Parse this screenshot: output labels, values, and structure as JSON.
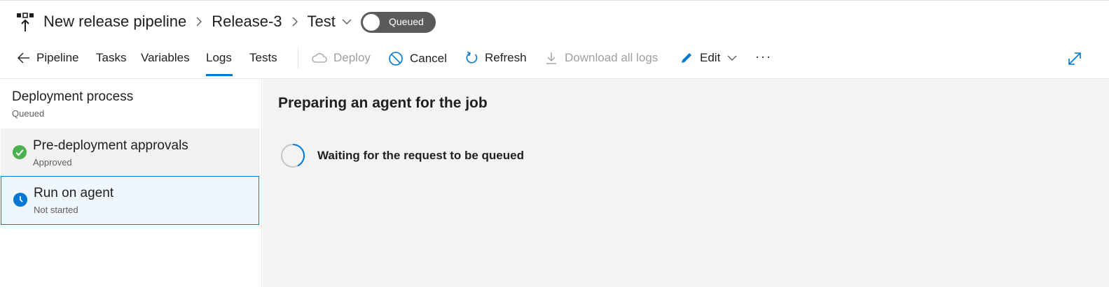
{
  "header": {
    "breadcrumbs": [
      "New release pipeline",
      "Release-3",
      "Test"
    ],
    "status_toggle": "Queued"
  },
  "toolbar": {
    "tabs": [
      {
        "label": "Pipeline"
      },
      {
        "label": "Tasks"
      },
      {
        "label": "Variables"
      },
      {
        "label": "Logs",
        "active": true
      },
      {
        "label": "Tests"
      }
    ],
    "commands": {
      "deploy": "Deploy",
      "cancel": "Cancel",
      "refresh": "Refresh",
      "download": "Download all logs",
      "edit": "Edit"
    },
    "more": "···"
  },
  "left_panel": {
    "title": "Deployment process",
    "status": "Queued",
    "steps": [
      {
        "title": "Pre-deployment approvals",
        "status": "Approved",
        "icon": "check-circle-icon"
      },
      {
        "title": "Run on agent",
        "status": "Not started",
        "icon": "clock-icon"
      }
    ]
  },
  "main": {
    "title": "Preparing an agent for the job",
    "status_text": "Waiting for the request to be queued"
  },
  "colors": {
    "accent": "#0078d4",
    "success": "#4caf50",
    "toggle_bg": "#5a5a5a",
    "main_bg": "#f3f3f3"
  }
}
